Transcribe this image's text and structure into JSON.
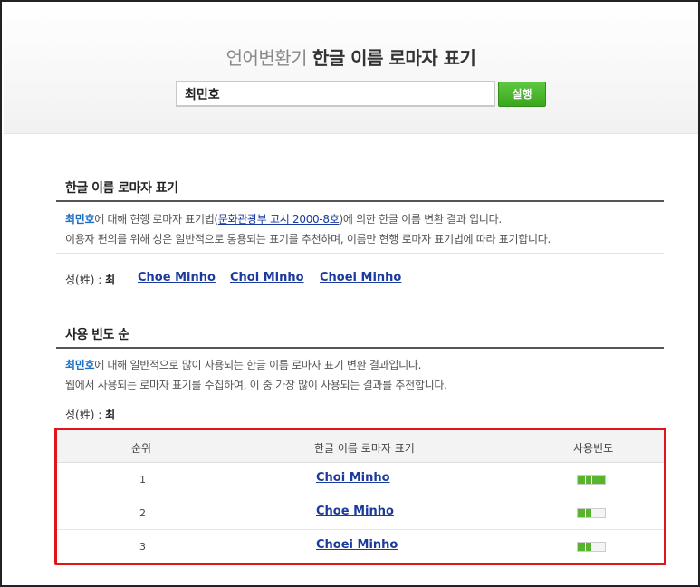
{
  "hero": {
    "title_sub": "언어변환기",
    "title_main": "한글 이름 로마자 표기",
    "search_value": "최민호",
    "run_label": "실행"
  },
  "section1": {
    "title": "한글 이름 로마자 표기",
    "name": "최민호",
    "line1_a": "에 대해 현행 로마자 표기법(",
    "law": "문화관광부 고시 2000-8호",
    "line1_b": ")에 의한 한글 이름 변환 결과 입니다.",
    "line2": "이용자 편의를 위해 성은 일반적으로 통용되는 표기를 추천하며, 이름만 현행 로마자 표기법에 따라 표기합니다.",
    "surname_label": "성(姓) :",
    "surname_value": "최",
    "options": [
      "Choe Minho",
      "Choi Minho",
      "Choei Minho"
    ]
  },
  "section2": {
    "title": "사용 빈도 순",
    "name": "최민호",
    "line1": "에 대해 일반적으로 많이 사용되는 한글 이름 로마자 표기 변환 결과입니다.",
    "line2": "웹에서 사용되는 로마자 표기를 수집하여, 이 중 가장 많이 사용되는 결과를 추천합니다.",
    "surname_label": "성(姓) :",
    "surname_value": "최",
    "table": {
      "headers": [
        "순위",
        "한글 이름 로마자 표기",
        "사용빈도"
      ],
      "rows": [
        {
          "rank": "1",
          "value": "Choi Minho",
          "frequency": 1.0
        },
        {
          "rank": "2",
          "value": "Choe Minho",
          "frequency": 0.5
        },
        {
          "rank": "3",
          "value": "Choei Minho",
          "frequency": 0.5
        }
      ]
    }
  },
  "colors": {
    "accent_green": "#3aa71c",
    "link_blue": "#1a3a9e",
    "highlight_red": "#e0151b"
  }
}
